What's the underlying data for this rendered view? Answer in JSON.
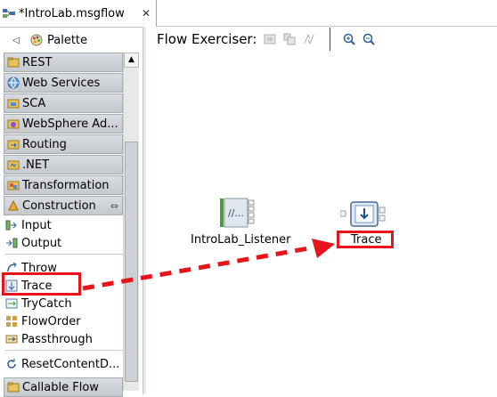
{
  "editor_tab": {
    "label": "*IntroLab.msgflow",
    "close": "✕"
  },
  "palette": {
    "title": "Palette",
    "collapse": "◁",
    "drawers": [
      {
        "label": "REST",
        "icon": "rest-folder-icon"
      },
      {
        "label": "Web Services",
        "icon": "web-services-icon"
      },
      {
        "label": "SCA",
        "icon": "sca-icon"
      },
      {
        "label": "WebSphere Ad...",
        "icon": "websphere-icon"
      },
      {
        "label": "Routing",
        "icon": "routing-icon"
      },
      {
        "label": ".NET",
        "icon": "dotnet-icon"
      },
      {
        "label": "Transformation",
        "icon": "transformation-icon"
      },
      {
        "label": "Construction",
        "icon": "construction-icon"
      }
    ],
    "entries": [
      {
        "label": "Input",
        "icon": "input-node-icon"
      },
      {
        "label": "Output",
        "icon": "output-node-icon"
      },
      {
        "label": "Throw",
        "icon": "throw-node-icon"
      },
      {
        "label": "Trace",
        "icon": "trace-node-icon"
      },
      {
        "label": "TryCatch",
        "icon": "trycatch-node-icon"
      },
      {
        "label": "FlowOrder",
        "icon": "floworder-node-icon"
      },
      {
        "label": "Passthrough",
        "icon": "passthrough-node-icon"
      },
      {
        "label": "ResetContentD...",
        "icon": "resetcontent-node-icon"
      }
    ],
    "bottom_drawer": {
      "label": "Callable Flow",
      "icon": "callable-flow-icon"
    }
  },
  "canvas": {
    "toolbar_label": "Flow Exerciser:",
    "nodes": [
      {
        "label": "IntroLab_Listener",
        "icon": "listener-node-icon"
      },
      {
        "label": "Trace",
        "icon": "trace-node-icon"
      }
    ]
  },
  "colors": {
    "highlight": "#e8141b",
    "drawer_bg": "#cdd1d6"
  }
}
